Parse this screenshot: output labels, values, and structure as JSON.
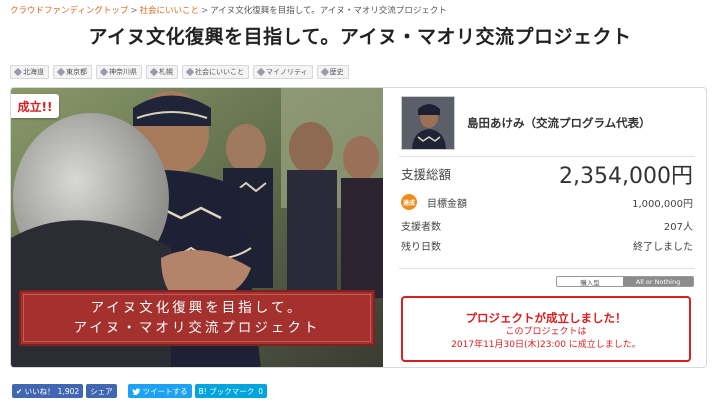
{
  "breadcrumb": {
    "items": [
      "クラウドファンディングトップ",
      "社会にいいこと",
      "アイヌ文化復興を目指して。アイヌ・マオリ交流プロジェクト"
    ],
    "separator": ">"
  },
  "title": "アイヌ文化復興を目指して。アイヌ・マオリ交流プロジェクト",
  "tags": [
    "北海道",
    "東京都",
    "神奈川県",
    "札幌",
    "社会にいいこと",
    "マイノリティ",
    "歴史"
  ],
  "hero": {
    "badge": "成立!!",
    "banner_line1": "アイヌ文化復興を目指して。",
    "banner_line2": "アイヌ・マオリ交流プロジェクト"
  },
  "owner": {
    "name": "島田あけみ（交流プログラム代表）"
  },
  "stats": {
    "total_label": "支援総額",
    "total_value": "2,354,000円",
    "goal_badge": "達成",
    "goal_label": "目標金額",
    "goal_value": "1,000,000円",
    "supporters_label": "支援者数",
    "supporters_value": "207人",
    "days_label": "残り日数",
    "days_value": "終了しました"
  },
  "funding_type": {
    "option_a": "購入型",
    "option_b": "All or Nothing",
    "selected": "All or Nothing"
  },
  "success": {
    "title": "プロジェクトが成立しました！",
    "line1": "このプロジェクトは",
    "line2": "2017年11月30日(木)23:00 に成立しました。"
  },
  "social": {
    "like_label": "いいね！",
    "like_count": "1,902",
    "share_label": "シェア",
    "tweet_label": "ツイートする",
    "hatena_label": "B! ブックマーク",
    "hatena_count": "0"
  },
  "colors": {
    "accent_red": "#d7201f",
    "breadcrumb_link": "#e0671f",
    "banner_red": "#a4312e",
    "facebook": "#4267b2",
    "twitter": "#1da1f2",
    "hatena": "#00a4de"
  }
}
